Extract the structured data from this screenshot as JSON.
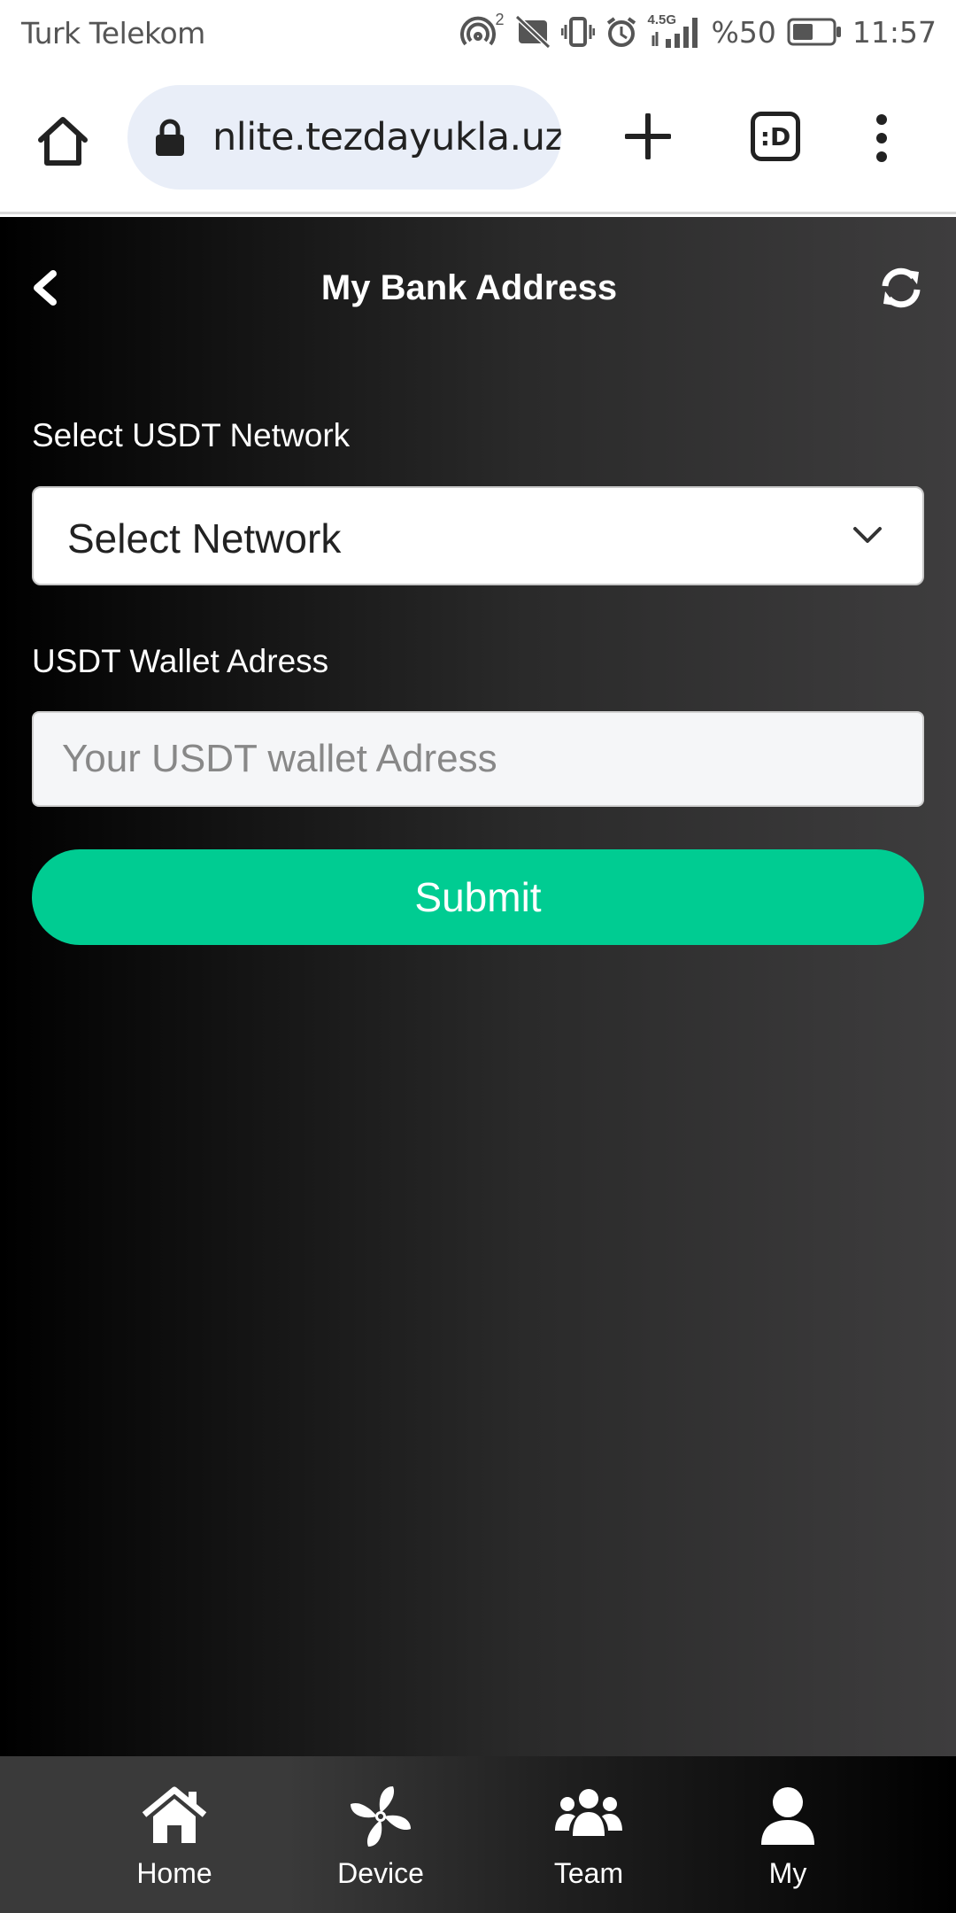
{
  "status_bar": {
    "carrier": "Turk Telekom",
    "hotspot_count": "2",
    "network_type": "4.5G",
    "battery": "%50",
    "time": "11:57"
  },
  "browser": {
    "url": "nlite.tezdayukla.uz",
    "tabs_label": ":D"
  },
  "page": {
    "title": "My Bank Address",
    "network_label": "Select USDT Network",
    "network_selected": "Select Network",
    "wallet_label": "USDT Wallet Adress",
    "wallet_placeholder": "Your USDT wallet Adress",
    "submit_label": "Submit"
  },
  "nav": {
    "items": [
      {
        "label": "Home",
        "icon": "home-icon"
      },
      {
        "label": "Device",
        "icon": "fan-icon"
      },
      {
        "label": "Team",
        "icon": "team-icon"
      },
      {
        "label": "My",
        "icon": "user-icon"
      }
    ]
  },
  "colors": {
    "accent": "#00cc92",
    "page_bg_dark": "#000000",
    "page_bg_light": "#3e3d3e"
  }
}
